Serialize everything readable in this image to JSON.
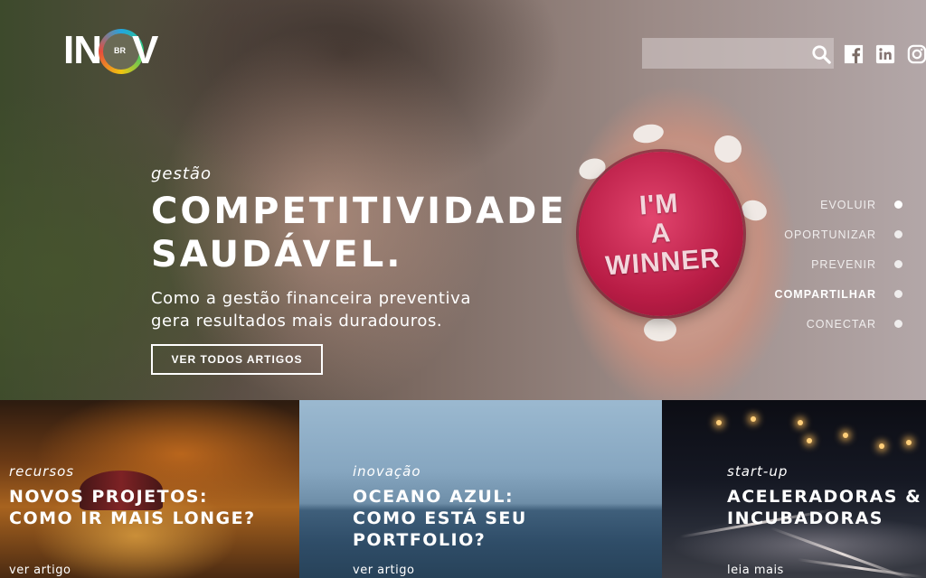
{
  "header": {
    "logo": {
      "left": "IN",
      "ring": "BR",
      "right": "V"
    },
    "search": {
      "placeholder": "",
      "value": ""
    },
    "social": [
      "facebook-icon",
      "linkedin-icon",
      "instagram-icon"
    ]
  },
  "hero": {
    "category": "gestão",
    "title_line1": "COMPETITIVIDADE",
    "title_line2": "SAUDÁVEL.",
    "subtitle_line1": "Como a gestão financeira preventiva",
    "subtitle_line2": "gera resultados mais duradouros.",
    "button_label": "VER TODOS ARTIGOS",
    "badge_lines": [
      "I'M",
      "A",
      "WINNER"
    ]
  },
  "side_nav": {
    "items": [
      {
        "label": "EVOLUIR"
      },
      {
        "label": "OPORTUNIZAR"
      },
      {
        "label": "PREVENIR"
      },
      {
        "label": "COMPARTILHAR"
      },
      {
        "label": "CONECTAR"
      }
    ],
    "active": "COMPARTILHAR"
  },
  "cards": [
    {
      "category": "recursos",
      "title_line1": "NOVOS PROJETOS:",
      "title_line2": "COMO IR MAIS LONGE?",
      "title_line3": "",
      "link": "ver artigo"
    },
    {
      "category": "inovação",
      "title_line1": "OCEANO AZUL:",
      "title_line2": "COMO ESTÁ SEU",
      "title_line3": "PORTFOLIO?",
      "link": "ver artigo"
    },
    {
      "category": "start-up",
      "title_line1": "ACELERADORAS &",
      "title_line2": "INCUBADORAS",
      "title_line3": "",
      "link": "leia mais"
    }
  ],
  "colors": {
    "badge": "#c0204a",
    "text": "#ffffff"
  }
}
